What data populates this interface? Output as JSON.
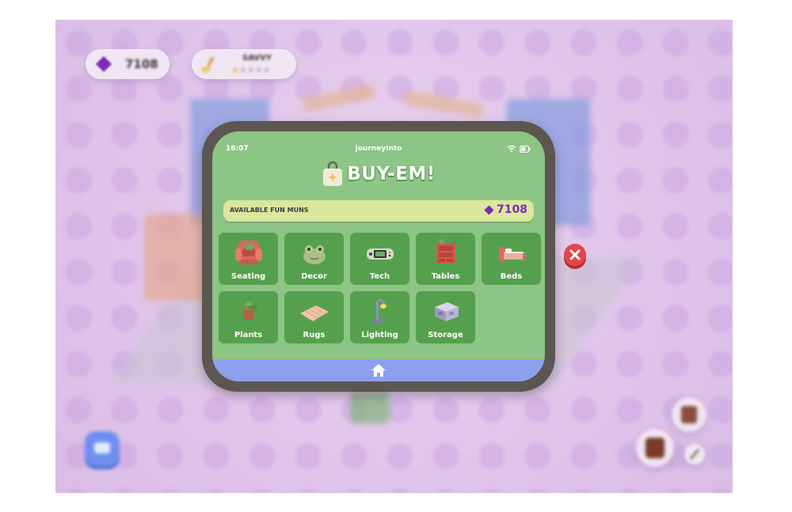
{
  "background_hud": {
    "gems_value": "7108",
    "level_label": "SAVVY",
    "level_stars_filled": 1,
    "level_stars_total": 5
  },
  "phone": {
    "status": {
      "time": "16:07",
      "carrier": "journeyInto"
    },
    "app_title": "BUY-EM!",
    "balance": {
      "label": "AVAILABLE FUN MUNS",
      "value": "7108"
    },
    "categories": [
      {
        "label": "Seating",
        "icon": "armchair-icon"
      },
      {
        "label": "Decor",
        "icon": "frog-icon"
      },
      {
        "label": "Tech",
        "icon": "game-console-icon"
      },
      {
        "label": "Tables",
        "icon": "dresser-icon"
      },
      {
        "label": "Beds",
        "icon": "bed-icon"
      },
      {
        "label": "Plants",
        "icon": "potted-plant-icon"
      },
      {
        "label": "Rugs",
        "icon": "rug-icon"
      },
      {
        "label": "Lighting",
        "icon": "lamp-icon"
      },
      {
        "label": "Storage",
        "icon": "storage-box-icon"
      }
    ],
    "nav": {
      "icon": "home-icon"
    }
  },
  "colors": {
    "screen": "#8cc585",
    "tile": "#55a04d",
    "gem": "#7b2bb5",
    "navbar": "#8e9ff0",
    "close": "#e04848"
  }
}
